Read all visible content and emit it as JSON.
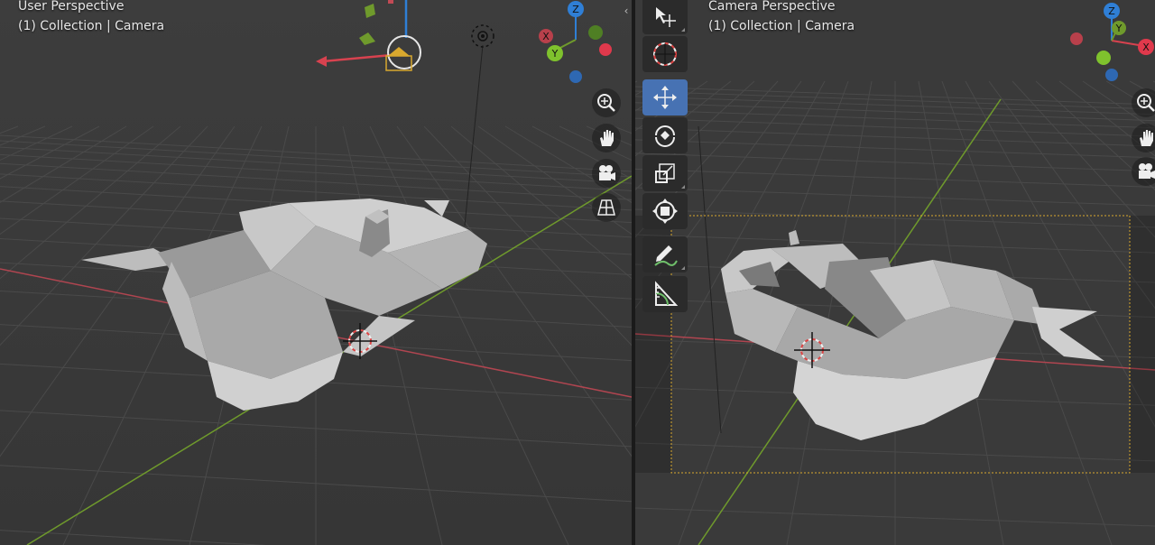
{
  "left_viewport": {
    "view_name": "User Perspective",
    "collection_label": "(1) Collection | Camera"
  },
  "right_viewport": {
    "view_name": "Camera Perspective",
    "collection_label": "(1) Collection | Camera"
  },
  "gizmo_axes": {
    "x": "X",
    "y": "Y",
    "z": "Z"
  },
  "nav_buttons": [
    "zoom-icon",
    "pan-hand-icon",
    "camera-view-icon",
    "ortho-grid-icon"
  ],
  "tools": [
    {
      "name": "select-box-tool",
      "active": false
    },
    {
      "name": "cursor-tool",
      "active": false
    },
    {
      "name": "move-tool",
      "active": true
    },
    {
      "name": "rotate-tool",
      "active": false
    },
    {
      "name": "scale-tool",
      "active": false
    },
    {
      "name": "transform-tool",
      "active": false
    },
    {
      "name": "annotate-tool",
      "active": false
    },
    {
      "name": "measure-tool",
      "active": false
    }
  ],
  "colors": {
    "viewport_bg": "#3b3b3b",
    "grid_line": "#4a4a4a",
    "x_axis": "#c24a55",
    "y_axis": "#6f9a2c",
    "z_axis": "#2f7fd6",
    "active_tool": "#4772b3",
    "camera_frame": "#d8a82e"
  }
}
